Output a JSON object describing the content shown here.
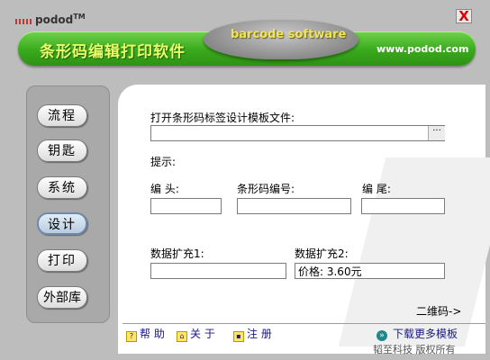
{
  "header": {
    "brand": "podod",
    "trademark": "TM",
    "app_title": "条形码编辑打印软件",
    "tagline": "barcode software",
    "url": "www.podod.com",
    "close_label": "X"
  },
  "sidebar": {
    "items": [
      {
        "label": "流程"
      },
      {
        "label": "钥匙"
      },
      {
        "label": "系统"
      },
      {
        "label": "设计",
        "active": true
      },
      {
        "label": "打印"
      },
      {
        "label": "外部库"
      }
    ]
  },
  "form": {
    "open_label": "打开条形码标签设计模板文件:",
    "open_value": "",
    "browse_label": "···",
    "hint_label": "提示:",
    "head_label": "编 头:",
    "head_value": "",
    "code_label": "条形码编号:",
    "code_value": "",
    "tail_label": "编 尾:",
    "tail_value": "",
    "ext1_label": "数据扩充1:",
    "ext1_value": "",
    "ext2_label": "数据扩充2:",
    "ext2_value": "价格: 3.60元",
    "qr_link": "二维码->"
  },
  "bottom": {
    "help": "帮 助",
    "about": "关 于",
    "register": "注 册",
    "more_templates": "下载更多模板"
  },
  "footer": {
    "copyright": "韬至科技 版权所有"
  },
  "colors": {
    "accent_green": "#39a91c",
    "title_yellow": "#eaff6a",
    "close_red": "#dd0000"
  }
}
